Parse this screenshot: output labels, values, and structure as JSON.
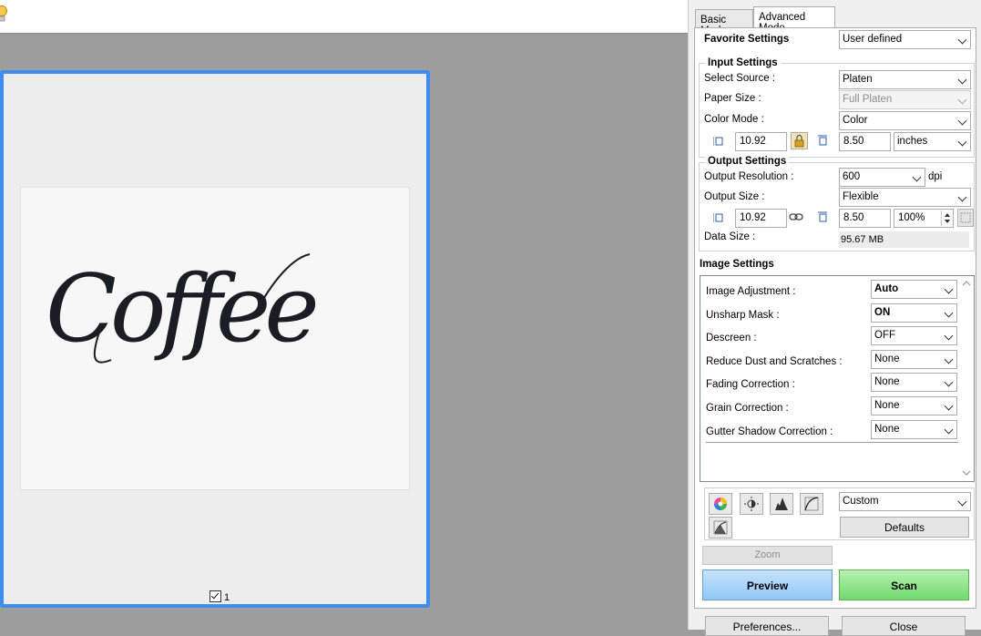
{
  "tabs": {
    "basic": "Basic Mode",
    "advanced": "Advanced Mode"
  },
  "favorite": {
    "label": "Favorite Settings",
    "value": "User defined"
  },
  "input_settings": {
    "title": "Input Settings",
    "select_source_label": "Select Source :",
    "select_source_value": "Platen",
    "paper_size_label": "Paper Size :",
    "paper_size_value": "Full Platen",
    "color_mode_label": "Color Mode :",
    "color_mode_value": "Color",
    "width": "10.92",
    "height": "8.50",
    "unit": "inches"
  },
  "output_settings": {
    "title": "Output Settings",
    "resolution_label": "Output Resolution :",
    "resolution_value": "600",
    "resolution_unit": "dpi",
    "size_label": "Output Size :",
    "size_value": "Flexible",
    "width": "10.92",
    "height": "8.50",
    "scale": "100%",
    "data_size_label": "Data Size :",
    "data_size_value": "95.67 MB"
  },
  "image_settings": {
    "title": "Image Settings",
    "rows": [
      {
        "label": "Image Adjustment :",
        "value": "Auto"
      },
      {
        "label": "Unsharp Mask :",
        "value": "ON"
      },
      {
        "label": "Descreen :",
        "value": "OFF"
      },
      {
        "label": "Reduce Dust and Scratches :",
        "value": "None"
      },
      {
        "label": "Fading Correction :",
        "value": "None"
      },
      {
        "label": "Grain Correction :",
        "value": "None"
      },
      {
        "label": "Gutter Shadow Correction :",
        "value": "None"
      }
    ]
  },
  "tone": {
    "preset": "Custom",
    "defaults_label": "Defaults"
  },
  "buttons": {
    "zoom": "Zoom",
    "preview": "Preview",
    "scan": "Scan",
    "preferences": "Preferences...",
    "close": "Close"
  },
  "preview": {
    "image_text": "Coffee",
    "thumb_number": "1"
  },
  "colors": {
    "accent": "#3d8ef0",
    "preview_btn": "#a9d4fb",
    "scan_btn": "#8fe38d"
  }
}
